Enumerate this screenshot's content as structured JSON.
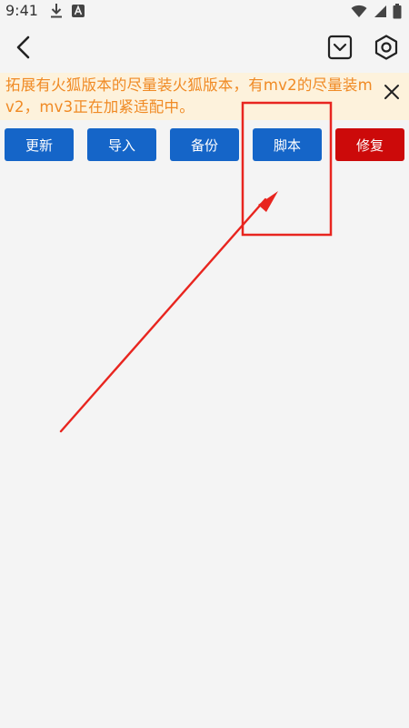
{
  "status_bar": {
    "time": "9:41",
    "left_icons": [
      "download-icon",
      "app-a-icon"
    ],
    "right_icons": [
      "wifi-icon",
      "cellular-icon",
      "battery-icon"
    ]
  },
  "nav": {
    "back_icon": "back-arrow-icon",
    "right_icons": [
      "notice-icon",
      "settings-icon"
    ]
  },
  "notice": {
    "text": "拓展有火狐版本的尽量装火狐版本，有mv2的尽量装mv2，mv3正在加紧适配中。",
    "close_icon": "close-icon",
    "text_color": "#f08a24",
    "background_color": "#fdf2dc"
  },
  "actions": {
    "update_label": "更新",
    "import_label": "导入",
    "backup_label": "备份",
    "script_label": "脚本",
    "repair_label": "修复",
    "primary_color": "#1565c8",
    "danger_color": "#cc0a0a"
  },
  "annotation": {
    "color": "#e8251f",
    "highlight_target": "script-button"
  }
}
